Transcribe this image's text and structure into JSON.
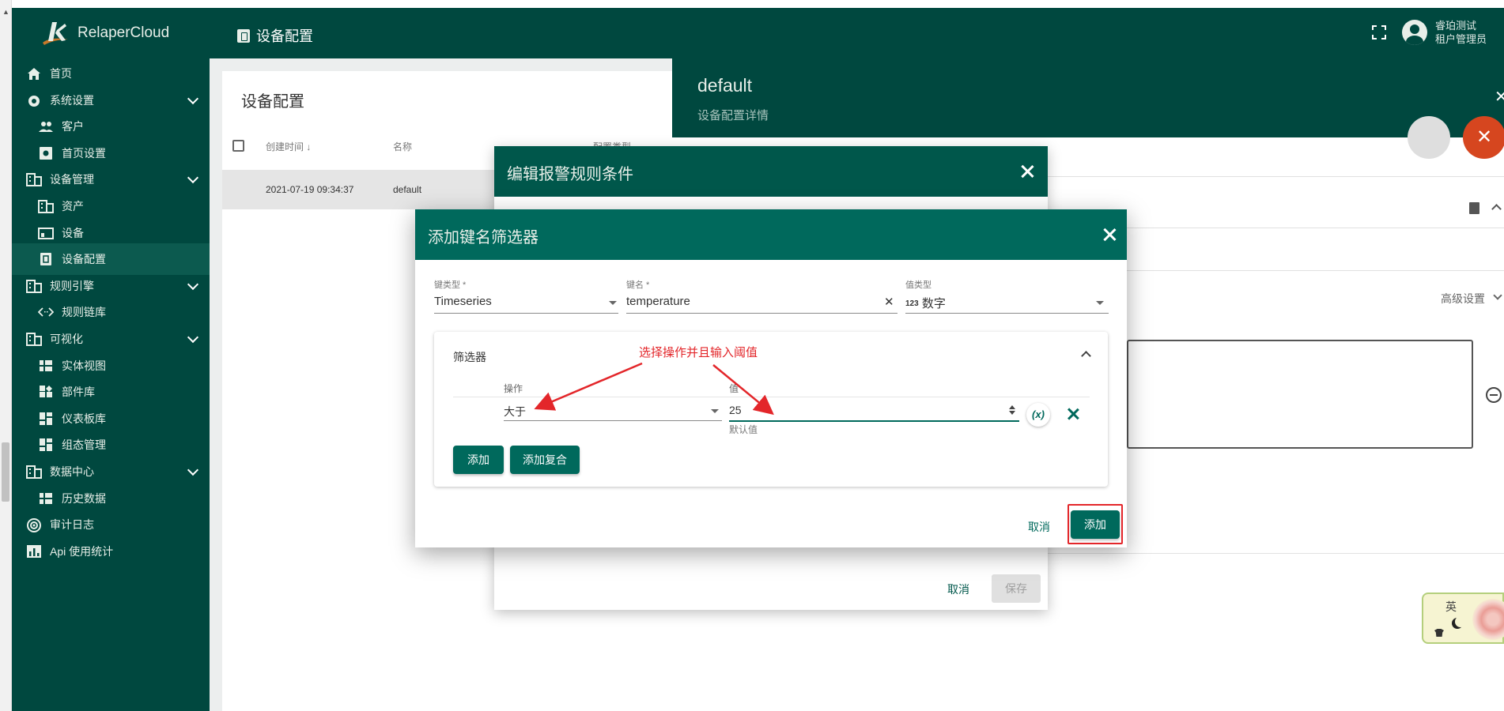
{
  "app": {
    "brand": "RelaperCloud",
    "page_heading": "设备配置",
    "user_name": "睿珀测试",
    "user_role": "租户管理员"
  },
  "sidebar": {
    "items": [
      {
        "label": "首页",
        "icon": "home-icon"
      },
      {
        "label": "系统设置",
        "icon": "gear-icon",
        "expandable": true
      },
      {
        "label": "客户",
        "icon": "people-icon",
        "sub": true
      },
      {
        "label": "首页设置",
        "icon": "settings-box-icon",
        "sub": true
      },
      {
        "label": "设备管理",
        "icon": "building-icon",
        "expandable": true
      },
      {
        "label": "资产",
        "icon": "building-icon",
        "sub": true
      },
      {
        "label": "设备",
        "icon": "device-icon",
        "sub": true
      },
      {
        "label": "设备配置",
        "icon": "doc-icon",
        "sub": true,
        "active": true
      },
      {
        "label": "规则引擎",
        "icon": "building-icon",
        "expandable": true
      },
      {
        "label": "规则链库",
        "icon": "code-icon",
        "sub": true
      },
      {
        "label": "可视化",
        "icon": "building-icon",
        "expandable": true
      },
      {
        "label": "实体视图",
        "icon": "grid-icon",
        "sub": true
      },
      {
        "label": "部件库",
        "icon": "widgets-icon",
        "sub": true
      },
      {
        "label": "仪表板库",
        "icon": "dashboard-icon",
        "sub": true
      },
      {
        "label": "组态管理",
        "icon": "dashboard-icon",
        "sub": true
      },
      {
        "label": "数据中心",
        "icon": "building-icon",
        "expandable": true
      },
      {
        "label": "历史数据",
        "icon": "grid-icon",
        "sub": true
      },
      {
        "label": "审计日志",
        "icon": "track-icon"
      },
      {
        "label": "Api 使用统计",
        "icon": "bar-chart-icon"
      }
    ]
  },
  "list": {
    "title": "设备配置",
    "columns": [
      "创建时间",
      "名称",
      "配置类型"
    ],
    "rows": [
      {
        "created": "2021-07-19 09:34:37",
        "name": "default"
      }
    ]
  },
  "detail": {
    "title": "default",
    "subtitle": "设备配置详情",
    "advanced": "高级设置"
  },
  "outer_dialog": {
    "title": "编辑报警规则条件",
    "cancel": "取消",
    "save": "保存"
  },
  "inner_dialog": {
    "title": "添加键名筛选器",
    "key_type_label": "键类型 *",
    "key_type_value": "Timeseries",
    "key_name_label": "键名 *",
    "key_name_value": "temperature",
    "value_type_label": "值类型",
    "value_type_icon": "123",
    "value_type_value": "数字",
    "filter_title": "筛选器",
    "op_label": "操作",
    "op_value": "大于",
    "val_label": "值",
    "val_value": "25",
    "val_hint": "默认值",
    "fx_label": "(x)",
    "add_btn": "添加",
    "add_complex_btn": "添加复合",
    "cancel": "取消",
    "confirm": "添加"
  },
  "annotation": "选择操作并且输入阈值",
  "ime": {
    "label": "英"
  },
  "colors": {
    "primary": "#00483f",
    "dialog_header": "#00695c",
    "annotation": "#e3262a",
    "fab": "#d6461f"
  }
}
